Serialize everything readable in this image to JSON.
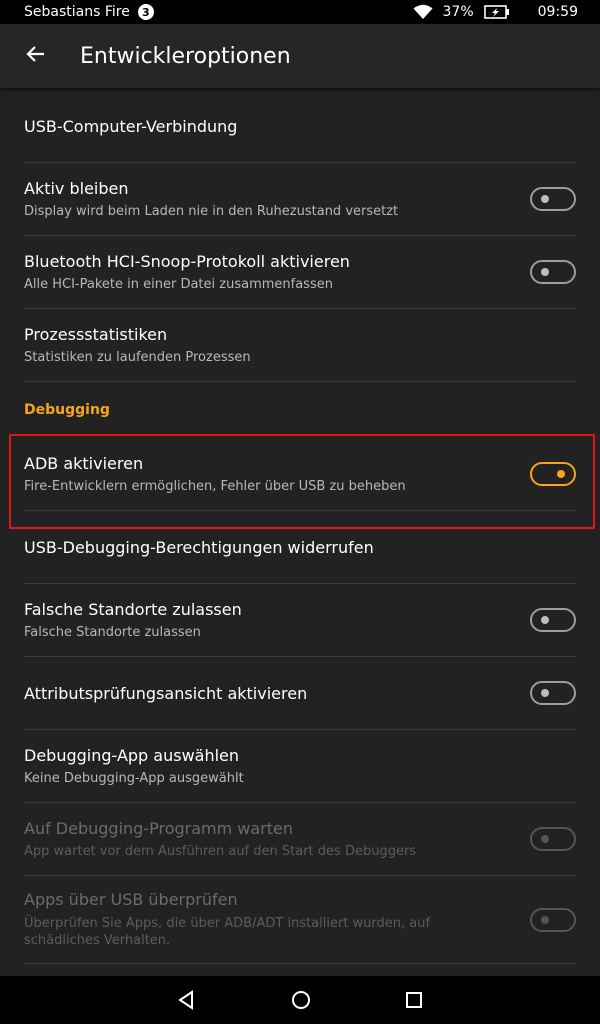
{
  "status_bar": {
    "device_name": "Sebastians Fire",
    "notification_count": "3",
    "battery_percent": "37%",
    "time": "09:59"
  },
  "app_bar": {
    "title": "Entwickleroptionen",
    "back_icon": "arrow-left-icon"
  },
  "items": [
    {
      "title": "USB-Computer-Verbindung"
    },
    {
      "title": "Aktiv bleiben",
      "sub": "Display wird beim Laden nie in den Ruhezustand versetzt",
      "toggle": "off"
    },
    {
      "title": "Bluetooth HCI-Snoop-Protokoll aktivieren",
      "sub": "Alle HCI-Pakete in einer Datei zusammenfassen",
      "toggle": "off"
    },
    {
      "title": "Prozessstatistiken",
      "sub": "Statistiken zu laufenden Prozessen"
    }
  ],
  "section": {
    "debugging": "Debugging"
  },
  "debug_items": [
    {
      "title": "ADB aktivieren",
      "sub": "Fire-Entwicklern ermöglichen, Fehler über USB zu beheben",
      "toggle": "on"
    },
    {
      "title": "USB-Debugging-Berechtigungen widerrufen"
    },
    {
      "title": "Falsche Standorte zulassen",
      "sub": "Falsche Standorte zulassen",
      "toggle": "off"
    },
    {
      "title": "Attributsprüfungsansicht aktivieren",
      "toggle": "off"
    },
    {
      "title": "Debugging-App auswählen",
      "sub": "Keine Debugging-App ausgewählt"
    },
    {
      "title": "Auf Debugging-Programm warten",
      "sub": "App wartet vor dem Ausführen auf den Start des Debuggers",
      "toggle": "disabled"
    },
    {
      "title": "Apps über USB überprüfen",
      "sub": "Überprüfen Sie Apps, die über ADB/ADT installiert wurden, auf schädliches Verhalten.",
      "toggle": "disabled"
    }
  ],
  "colors": {
    "accent": "#f8a51b",
    "background": "#222222",
    "highlight": "#e4141b"
  },
  "nav_icons": [
    "back-triangle-icon",
    "home-circle-icon",
    "recents-square-icon"
  ]
}
